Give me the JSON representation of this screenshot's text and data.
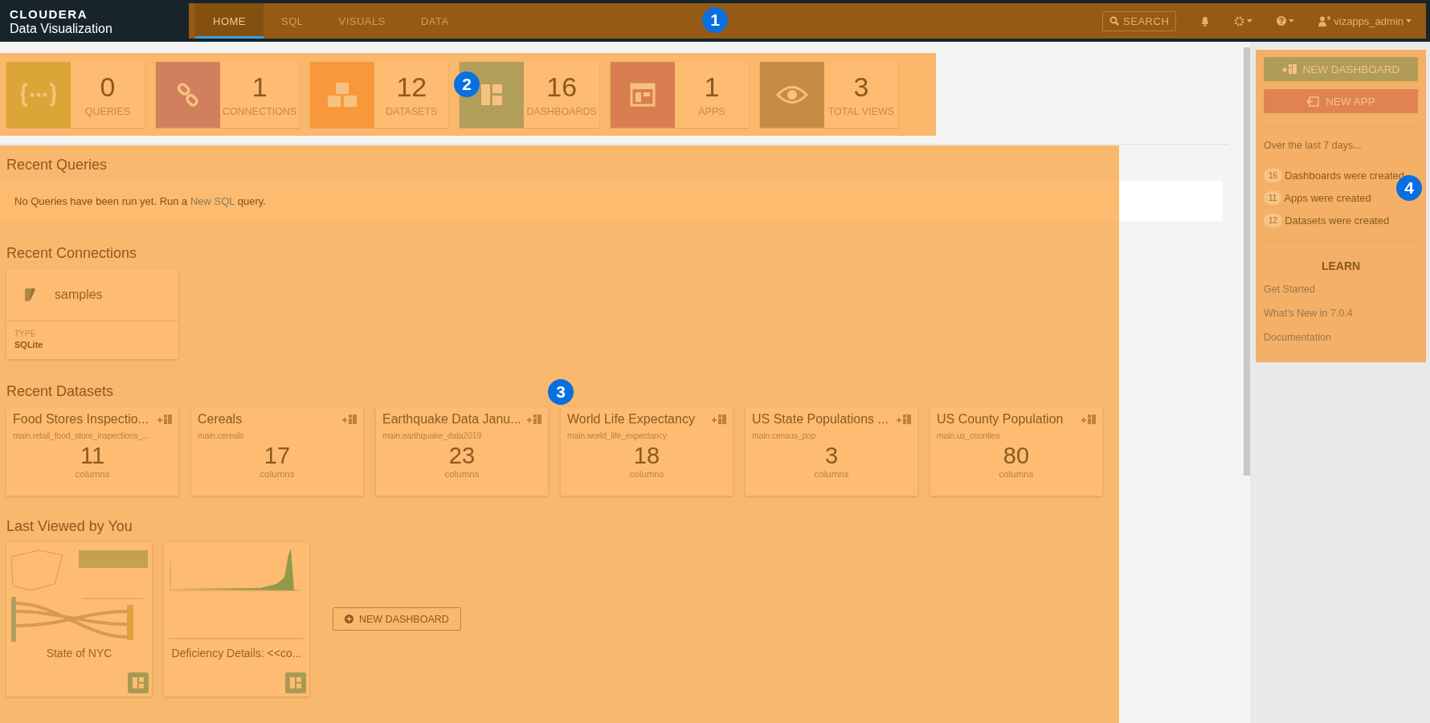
{
  "header": {
    "brand": "CLOUDERA",
    "product": "Data Visualization",
    "tabs": [
      {
        "label": "HOME",
        "selected": true
      },
      {
        "label": "SQL",
        "selected": false
      },
      {
        "label": "VISUALS",
        "selected": false
      },
      {
        "label": "DATA",
        "selected": false
      }
    ],
    "search_label": "SEARCH",
    "user": "vizapps_admin"
  },
  "stats": [
    {
      "kind": "braces",
      "value": "0",
      "label": "QUERIES",
      "color": "#dba637"
    },
    {
      "kind": "link",
      "value": "1",
      "label": "CONNECTIONS",
      "color": "#d07f5f"
    },
    {
      "kind": "cubes",
      "value": "12",
      "label": "DATASETS",
      "color": "#f7993a"
    },
    {
      "kind": "dashboard",
      "value": "16",
      "label": "DASHBOARDS",
      "color": "#b19e5a"
    },
    {
      "kind": "app",
      "value": "1",
      "label": "APPS",
      "color": "#d97e50"
    },
    {
      "kind": "eye",
      "value": "3",
      "label": "TOTAL VIEWS",
      "color": "#c68b45"
    }
  ],
  "recent_queries": {
    "title": "Recent Queries",
    "message": "No Queries have been run yet. Run a ",
    "link": "New SQL",
    "message_end": " query."
  },
  "recent_connections": {
    "title": "Recent Connections",
    "items": [
      {
        "name": "samples",
        "type_label": "TYPE",
        "type": "SQLite"
      }
    ]
  },
  "recent_datasets": {
    "title": "Recent Datasets",
    "items": [
      {
        "name": "Food Stores Inspectio...",
        "table": "main.retail_food_store_inspections_...",
        "count": "11",
        "unit": "columns"
      },
      {
        "name": "Cereals",
        "table": "main.cereals",
        "count": "17",
        "unit": "columns"
      },
      {
        "name": "Earthquake Data Janu...",
        "table": "main.earthquake_data2019",
        "count": "23",
        "unit": "columns"
      },
      {
        "name": "World Life Expectancy",
        "table": "main.world_life_expectancy",
        "count": "18",
        "unit": "columns"
      },
      {
        "name": "US State Populations ...",
        "table": "main.census_pop",
        "count": "3",
        "unit": "columns"
      },
      {
        "name": "US County Population",
        "table": "main.us_counties",
        "count": "80",
        "unit": "columns"
      }
    ]
  },
  "last_viewed": {
    "title": "Last Viewed by You",
    "items": [
      {
        "kind": "map",
        "name": "State of NYC"
      },
      {
        "kind": "histogram",
        "name": "Deficiency Details: <<co..."
      }
    ],
    "new_dashboard": "NEW DASHBOARD"
  },
  "sidebar": {
    "new_dashboard": "NEW DASHBOARD",
    "new_app": "NEW APP",
    "period": "Over the last 7 days...",
    "activity": [
      {
        "count": "16",
        "text": "Dashboards were created"
      },
      {
        "count": "11",
        "text": "Apps were created"
      },
      {
        "count": "12",
        "text": "Datasets were created"
      }
    ],
    "learn_title": "LEARN",
    "links": [
      "Get Started",
      "What's New in 7.0.4",
      "Documentation"
    ]
  },
  "callouts": [
    "1",
    "2",
    "3",
    "4"
  ]
}
